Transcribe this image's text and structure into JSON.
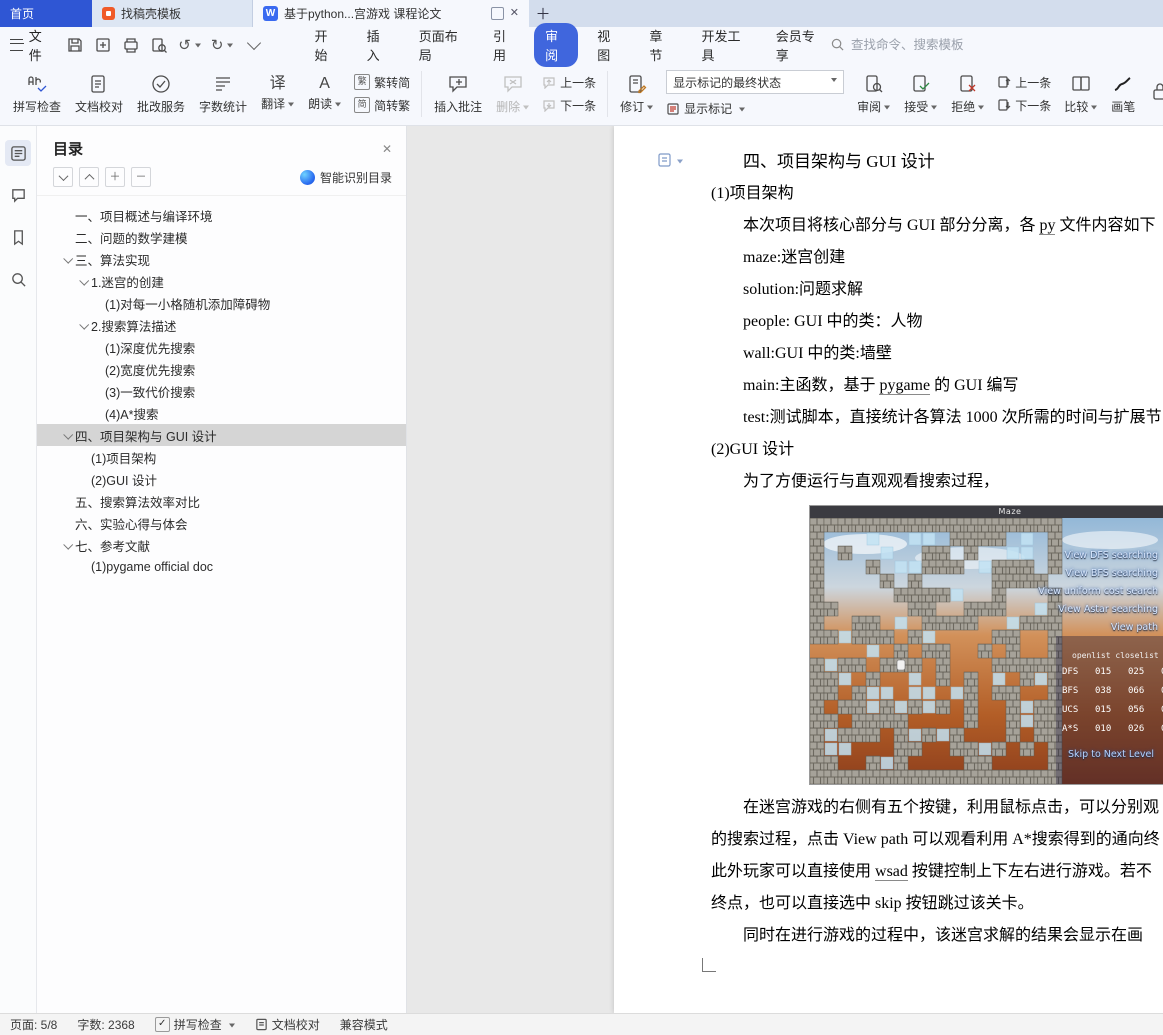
{
  "window": {
    "tabs": [
      {
        "label": "首页"
      },
      {
        "label": "找稿壳模板"
      },
      {
        "label": "基于python...宫游戏 课程论文"
      }
    ]
  },
  "menubar": {
    "file_label": "文件",
    "menus": [
      "开始",
      "插入",
      "页面布局",
      "引用",
      "审阅",
      "视图",
      "章节",
      "开发工具",
      "会员专享"
    ],
    "active_menu": "审阅",
    "search_placeholder": "查找命令、搜索模板"
  },
  "ribbon": {
    "spell_check": "拼写检查",
    "doc_proof": "文档校对",
    "correction": "批改服务",
    "word_count": "字数统计",
    "translate": "翻译",
    "read_aloud": "朗读",
    "trad_to_simp": "繁转简",
    "simp_to_trad": "简转繁",
    "insert_comment": "插入批注",
    "delete": "删除",
    "prev_comment": "上一条",
    "next_comment": "下一条",
    "revise": "修订",
    "markup_state": "显示标记的最终状态",
    "show_markup": "显示标记",
    "review": "审阅",
    "accept": "接受",
    "reject": "拒绝",
    "prev_change": "上一条",
    "next_change": "下一条",
    "compare": "比较",
    "pen": "画笔"
  },
  "toc": {
    "title": "目录",
    "smart_recognize": "智能识别目录",
    "items": [
      {
        "label": "一、项目概述与编译环境"
      },
      {
        "label": "二、问题的数学建模"
      },
      {
        "label": "三、算法实现"
      },
      {
        "label": "1.迷宫的创建"
      },
      {
        "label": "(1)对每一小格随机添加障碍物"
      },
      {
        "label": "2.搜索算法描述"
      },
      {
        "label": "(1)深度优先搜索"
      },
      {
        "label": "(2)宽度优先搜索"
      },
      {
        "label": "(3)一致代价搜索"
      },
      {
        "label": "(4)A*搜索"
      },
      {
        "label": "四、项目架构与 GUI 设计"
      },
      {
        "label": "(1)项目架构"
      },
      {
        "label": "(2)GUI 设计"
      },
      {
        "label": "五、搜索算法效率对比"
      },
      {
        "label": "六、实验心得与体会"
      },
      {
        "label": "七、参考文献"
      },
      {
        "label": "(1)pygame official doc"
      }
    ]
  },
  "document": {
    "heading": "四、项目架构与 GUI 设计",
    "p1": "(1)项目架构",
    "p2a": "本次项目将核心部分与 GUI 部分分离，各 ",
    "p2b": "py",
    "p2c": " 文件内容如下",
    "p3": "maze:迷宫创建",
    "p4": "solution:问题求解",
    "p5": "people: GUI 中的类：人物",
    "p6": "wall:GUI 中的类:墙壁",
    "p7a": "main:主函数，基于 ",
    "p7b": "pygame",
    "p7c": " 的 GUI 编写",
    "p8": "test:测试脚本，直接统计各算法 1000 次所需的时间与扩展节",
    "p9": "(2)GUI 设计",
    "p10": "为了方便运行与直观观看搜索过程，",
    "p11": "在迷宫游戏的右侧有五个按键，利用鼠标点击，可以分别观",
    "p12": "的搜索过程，点击 View path 可以观看利用 A*搜索得到的通向终",
    "p13a": "此外玩家可以直接使用 ",
    "p13b": "wsad",
    "p13c": " 按键控制上下左右进行游戏。若不",
    "p14": "终点，也可以直接选中 skip 按钮跳过该关卡。",
    "p15": "同时在进行游戏的过程中，该迷宫求解的结果会显示在画"
  },
  "game": {
    "title": "Maze",
    "menu": [
      "View DFS searching",
      "View BFS searching",
      "View uniform cost search",
      "View Astar searching",
      "View path"
    ],
    "stats_header": "openlist closelist pa",
    "stats": [
      {
        "name": "DFS",
        "values": [
          "015",
          "025",
          "0"
        ]
      },
      {
        "name": "BFS",
        "values": [
          "038",
          "066",
          "0"
        ]
      },
      {
        "name": "UCS",
        "values": [
          "015",
          "056",
          "0"
        ]
      },
      {
        "name": "A*S",
        "values": [
          "010",
          "026",
          "0"
        ]
      }
    ],
    "skip": "Skip to Next Level"
  },
  "statusbar": {
    "page": "页面: 5/8",
    "words": "字数: 2368",
    "spell": "拼写检查",
    "proof": "文档校对",
    "mode": "兼容模式"
  },
  "icons": {
    "writer": "W",
    "abc": "abc",
    "translate_char": "译",
    "read_char": "A",
    "jian": "简",
    "fan": "繁",
    "undo": "↺",
    "redo": "↻",
    "close": "✕",
    "plus": "＋",
    "minus": "－",
    "check": "✓"
  },
  "colors": {
    "accent_blue": "#2f56d4",
    "pill_blue": "#4066dd",
    "tabbar_bg": "#d3dded",
    "selected_toc_bg": "#d5d5d5"
  }
}
